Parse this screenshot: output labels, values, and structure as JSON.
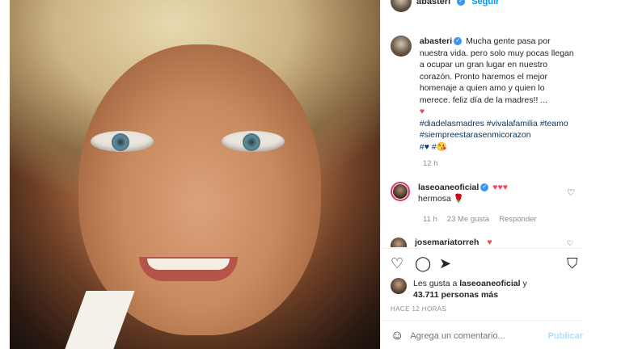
{
  "header": {
    "username": "abasteri",
    "follow_label": "Seguir"
  },
  "caption": {
    "username": "abasteri",
    "text": "Mucha gente pasa por nuestra vida. pero solo muy pocas llegan a ocupar un gran lugar en nuestro corazón. Pronto haremos el mejor homenaje a quien amo y quien lo merece. feliz día de la madres!! ...",
    "heart": "♥",
    "hashtags": "#diadelasmadres #vivalafamilia #teamo #siempreestarasenmicorazon",
    "trailing_emoji": "#♥ #😘",
    "time": "12 h"
  },
  "comment": {
    "username": "laseoaneoficial",
    "hearts": "♥♥♥",
    "text": "hermosa 🌹",
    "time": "11 h",
    "likes": "23 Me gusta",
    "reply_label": "Responder"
  },
  "comment2": {
    "username": "josemariatorreh",
    "hearts": "♥"
  },
  "likes": {
    "prefix": "Les gusta a",
    "user": "laseoaneoficial",
    "conjunction": "y",
    "count": "43.711 personas más"
  },
  "posted": "HACE 12 HORAS",
  "add_comment": {
    "placeholder": "Agrega un comentario...",
    "publish_label": "Publicar"
  },
  "icons": {
    "heart": "heart-icon",
    "comment": "comment-icon",
    "share": "share-icon",
    "save": "bookmark-icon",
    "emoji": "emoji-icon"
  },
  "colors": {
    "link": "#0095f6",
    "hashtag": "#00376b",
    "heart": "#ed4956",
    "muted": "#8e8e8e"
  }
}
